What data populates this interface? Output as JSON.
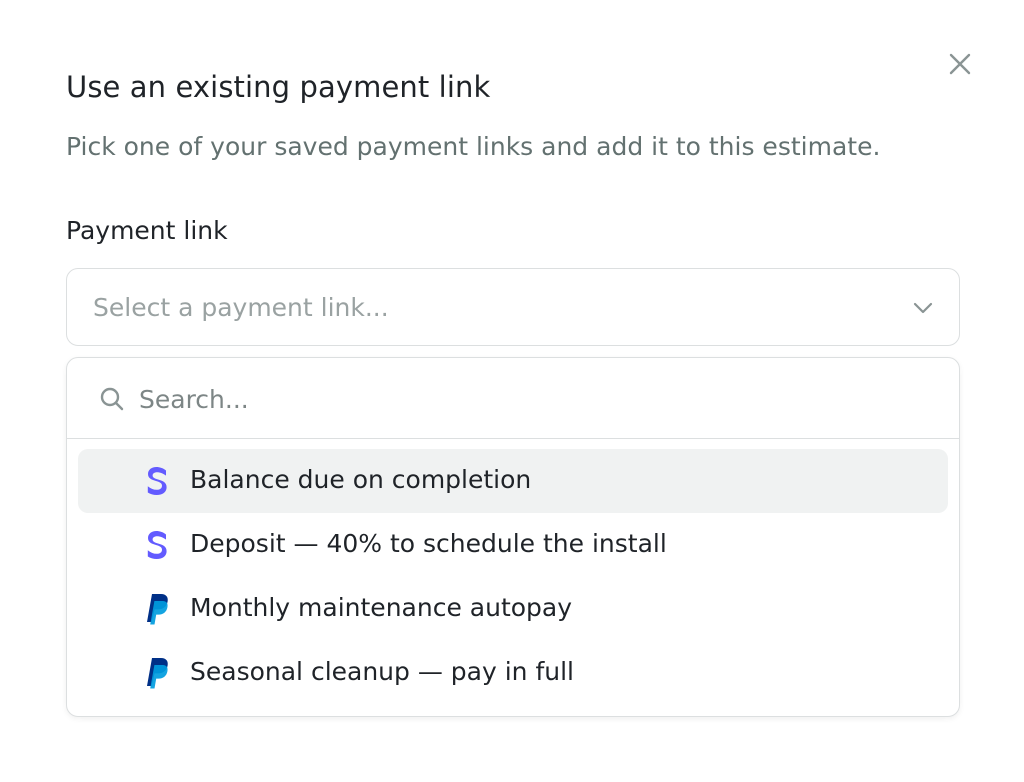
{
  "dialog": {
    "title": "Use an existing payment link",
    "subtitle": "Pick one of your saved payment links and add it to this estimate.",
    "close_icon": "close-icon"
  },
  "field": {
    "label": "Payment link",
    "placeholder": "Select a payment link...",
    "chevron_icon": "chevron-down-icon"
  },
  "search": {
    "icon": "search-icon",
    "placeholder": "Search..."
  },
  "options": [
    {
      "label": "Balance due on completion",
      "provider": "stripe",
      "icon": "stripe-icon",
      "highlighted": true
    },
    {
      "label": "Deposit — 40% to schedule the install",
      "provider": "stripe",
      "icon": "stripe-icon",
      "highlighted": false
    },
    {
      "label": "Monthly maintenance autopay",
      "provider": "paypal",
      "icon": "paypal-icon",
      "highlighted": false
    },
    {
      "label": "Seasonal cleanup — pay in full",
      "provider": "paypal",
      "icon": "paypal-icon",
      "highlighted": false
    }
  ],
  "colors": {
    "stripe": "#635bff",
    "paypal_dark": "#003087",
    "paypal_light": "#009cde",
    "highlight_bg": "#f0f2f2",
    "border": "#dcdfe0",
    "muted_text": "#637170"
  }
}
